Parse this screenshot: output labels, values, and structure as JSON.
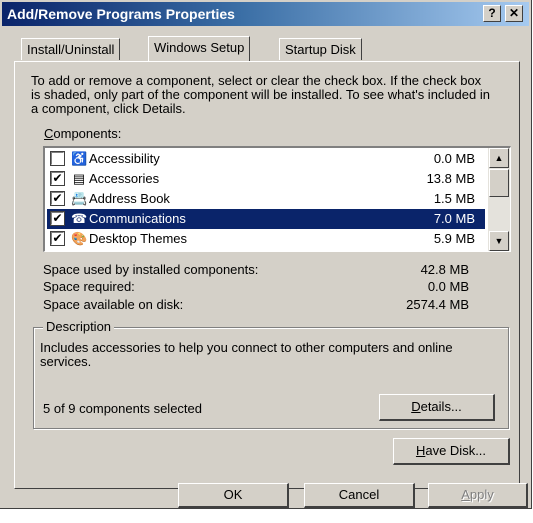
{
  "window": {
    "title": "Add/Remove Programs Properties",
    "help_label": "?",
    "close_label": "✕"
  },
  "tabs": [
    {
      "label": "Install/Uninstall",
      "active": false
    },
    {
      "label": "Windows Setup",
      "active": true
    },
    {
      "label": "Startup Disk",
      "active": false
    }
  ],
  "instructions": "To add or remove a component, select or clear the check box. If the check box is shaded, only part of the component will be installed. To see what's included in a component, click Details.",
  "components_label": {
    "accel": "C",
    "rest": "omponents:"
  },
  "components": [
    {
      "name": "Accessibility",
      "size": "0.0 MB",
      "checked": false,
      "icon": "wheelchair-icon",
      "glyph": "♿",
      "selected": false
    },
    {
      "name": "Accessories",
      "size": "13.8 MB",
      "checked": true,
      "icon": "accessories-icon",
      "glyph": "▤",
      "selected": false
    },
    {
      "name": "Address Book",
      "size": "1.5 MB",
      "checked": true,
      "icon": "address-book-icon",
      "glyph": "📇",
      "selected": false
    },
    {
      "name": "Communications",
      "size": "7.0 MB",
      "checked": true,
      "icon": "phone-icon",
      "glyph": "☎",
      "selected": true
    },
    {
      "name": "Desktop Themes",
      "size": "5.9 MB",
      "checked": true,
      "icon": "desktop-themes-icon",
      "glyph": "🎨",
      "selected": false
    }
  ],
  "stats": [
    {
      "label": "Space used by installed components:",
      "value": "42.8 MB"
    },
    {
      "label": "Space required:",
      "value": "0.0 MB"
    },
    {
      "label": "Space available on disk:",
      "value": "2574.4 MB"
    }
  ],
  "description": {
    "title": "Description",
    "text": "Includes accessories to help you connect to other computers and online services.",
    "selected_count": "5 of 9 components selected"
  },
  "buttons": {
    "details": {
      "accel": "D",
      "rest": "etails..."
    },
    "have_disk": {
      "accel": "H",
      "rest": "ave Disk..."
    },
    "ok": "OK",
    "cancel": "Cancel",
    "apply": {
      "accel": "A",
      "rest": "pply"
    }
  },
  "colors": {
    "title_start": "#0a246a",
    "title_end": "#a6caf0",
    "face": "#d4d0c8",
    "selection": "#0a246a"
  }
}
